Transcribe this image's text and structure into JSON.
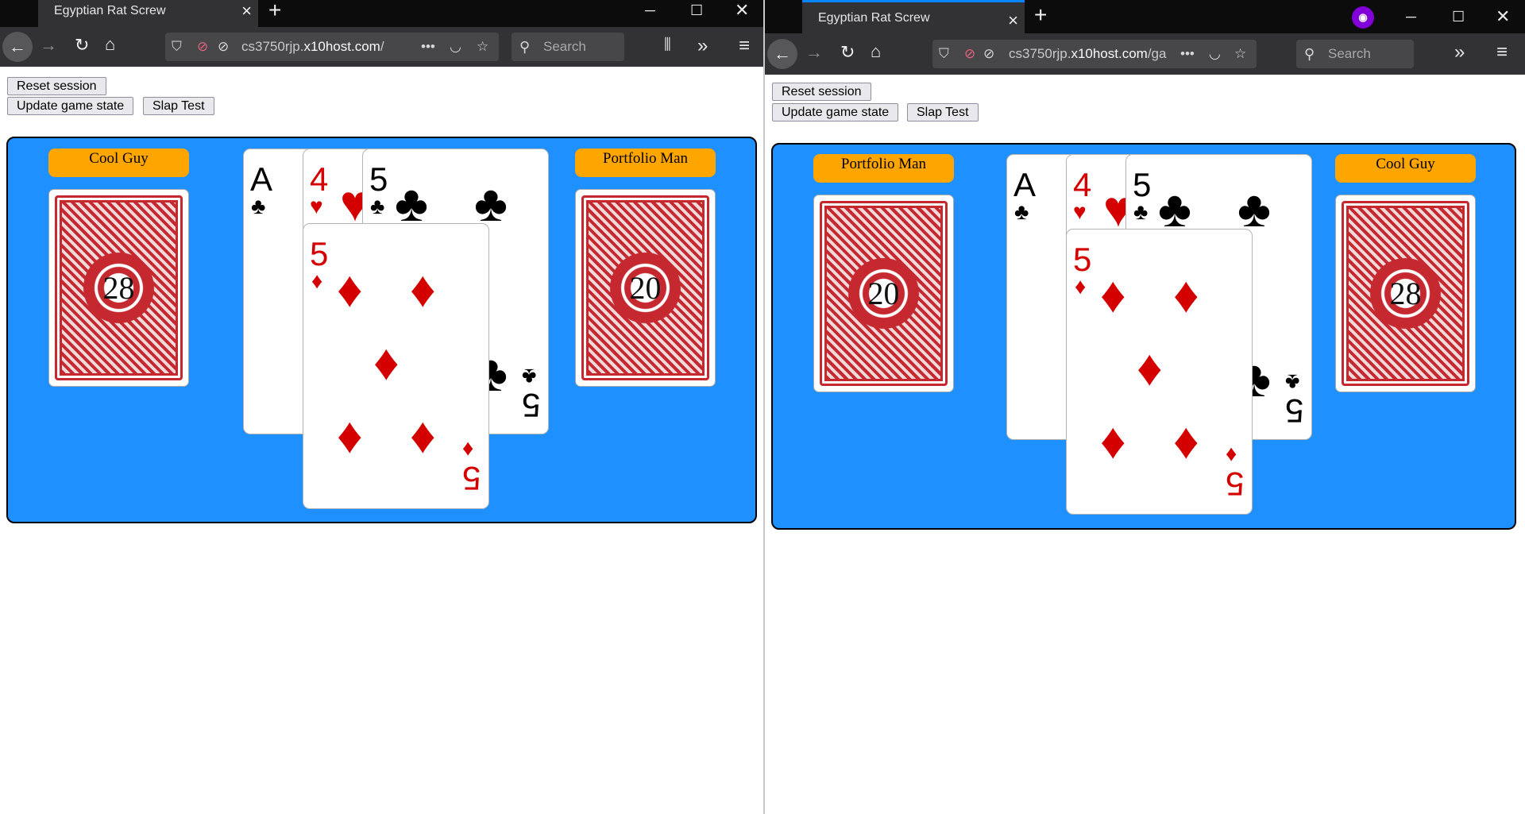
{
  "browser": {
    "tab_title": "Egyptian Rat Screw",
    "tab_close": "×",
    "new_tab": "+",
    "url_prefix": "cs3750rjp.",
    "url_host": "x10host.com",
    "url_left_suffix": "/",
    "url_right_suffix": "/ga",
    "search_placeholder": "Search",
    "overflow": "•••",
    "chevrons": "»",
    "menu": "≡"
  },
  "page": {
    "reset_label": "Reset session",
    "update_label": "Update game state",
    "slap_label": "Slap Test"
  },
  "left_view": {
    "left_player": "Cool Guy",
    "left_count": "28",
    "right_player": "Portfolio Man",
    "right_count": "20"
  },
  "right_view": {
    "left_player": "Portfolio Man",
    "left_count": "20",
    "right_player": "Cool Guy",
    "right_count": "28"
  },
  "pile": {
    "card1": {
      "rank": "A",
      "suit": "♣"
    },
    "card2": {
      "rank": "4",
      "suit": "♥"
    },
    "card3": {
      "rank": "5",
      "suit": "♣"
    },
    "card4": {
      "rank": "5",
      "suit": "♦"
    }
  },
  "colors": {
    "board": "#1e90ff",
    "name_tag": "#ffa500",
    "card_red": "#d40000"
  },
  "icons": [
    "back-arrow-icon",
    "forward-arrow-icon",
    "reload-icon",
    "home-icon",
    "shield-icon",
    "pocket-icon",
    "bookmark-star-icon",
    "library-icon",
    "chevrons-icon",
    "menu-icon",
    "search-icon",
    "private-mask-icon"
  ]
}
